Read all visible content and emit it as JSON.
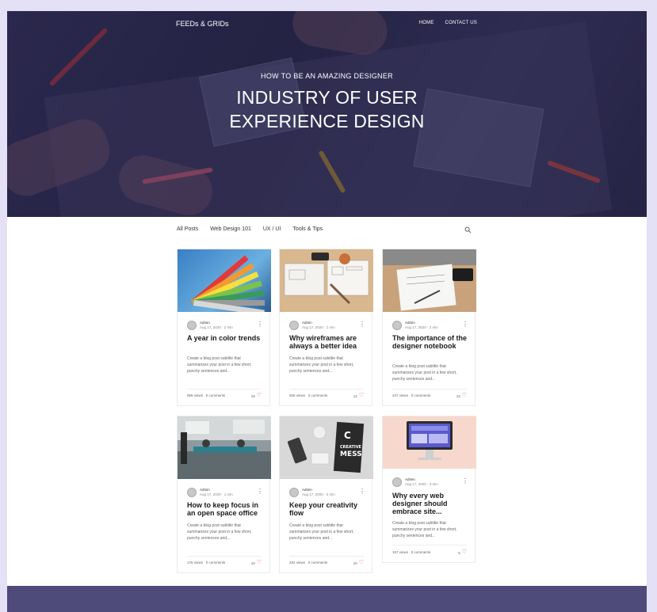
{
  "site": {
    "brand": "FEEDs & GRIDs"
  },
  "nav": [
    {
      "label": "HOME"
    },
    {
      "label": "CONTACT US"
    }
  ],
  "hero": {
    "kicker": "HOW TO BE AN AMAZING DESIGNER",
    "title_line1": "INDUSTRY OF USER",
    "title_line2": "EXPERIENCE DESIGN"
  },
  "filters": [
    "All Posts",
    "Web Design 101",
    "UX / UI",
    "Tools & Tips"
  ],
  "posts": [
    {
      "author": "Admin",
      "date": "Aug 17, 2020",
      "read": "2 min",
      "title": "A year in color trends",
      "excerpt": "Create a blog post subtitle that summarizes your post in a few short, punchy sentences and...",
      "views": "958 views",
      "comments": "0 comments",
      "likes": "19"
    },
    {
      "author": "Admin",
      "date": "Aug 17, 2020",
      "read": "1 min",
      "title": "Why wireframes are always a better idea",
      "excerpt": "Create a blog post subtitle that summarizes your post in a few short, punchy sentences and...",
      "views": "506 views",
      "comments": "0 comments",
      "likes": "12"
    },
    {
      "author": "Admin",
      "date": "Aug 17, 2020",
      "read": "2 min",
      "title": "The importance of the designer notebook",
      "excerpt": "Create a blog post subtitle that summarizes your post in a few short, punchy sentences and...",
      "views": "237 views",
      "comments": "0 comments",
      "likes": "13"
    },
    {
      "author": "Admin",
      "date": "Aug 17, 2020",
      "read": "1 min",
      "title": "How to keep focus in an open space office",
      "excerpt": "Create a blog post subtitle that summarizes your post in a few short, punchy sentences and...",
      "views": "176 views",
      "comments": "0 comments",
      "likes": "10"
    },
    {
      "author": "Admin",
      "date": "Aug 17, 2020",
      "read": "2 min",
      "title": "Keep your creativity flow",
      "excerpt": "Create a blog post subtitle that summarizes your post in a few short, punchy sentences and...",
      "views": "252 views",
      "comments": "0 comments",
      "likes": "10"
    },
    {
      "author": "Admin",
      "date": "Aug 17, 2020",
      "read": "3 min",
      "title": "Why every web designer should embrace site...",
      "excerpt": "Create a blog post subtitle that summarizes your post in a few short, punchy sentences and...",
      "views": "157 views",
      "comments": "0 comments",
      "likes": "5"
    }
  ],
  "thumb_text": {
    "creative_mess": "C\nCREATIVE\nMESS"
  },
  "colors": {
    "hero_overlay": "#2b2950",
    "heart": "#e0454f",
    "footer": "#4e4b7a",
    "page_bg": "#e4e0f5"
  }
}
